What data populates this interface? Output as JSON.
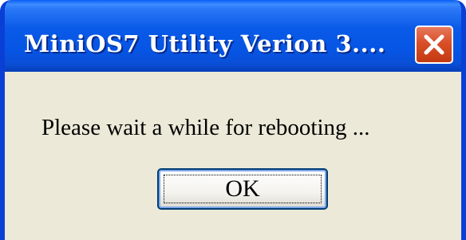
{
  "window": {
    "title": "MiniOS7 Utility Verion 3....",
    "close_icon": "close-x-icon"
  },
  "dialog": {
    "message": "Please wait a while for rebooting ...",
    "ok_label": "OK"
  },
  "colors": {
    "titlebar": "#0a5ae8",
    "close_button": "#d94f28",
    "dialog_background": "#ece9d8",
    "button_border": "#003c74"
  }
}
